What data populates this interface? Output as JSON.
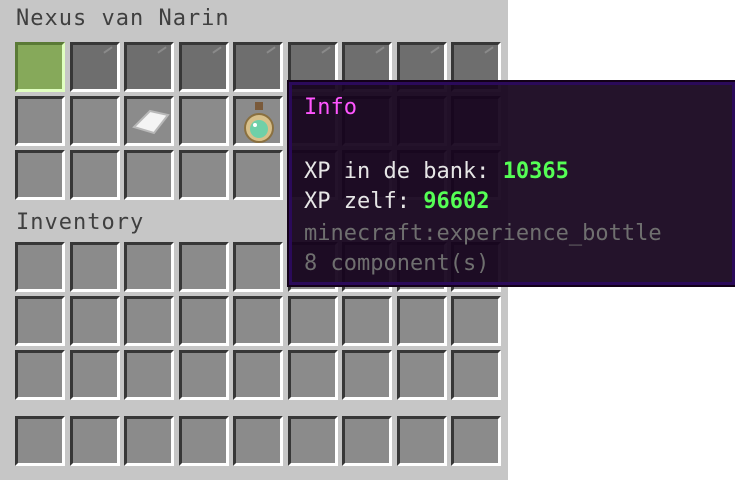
{
  "container": {
    "title": "Nexus van Narin"
  },
  "inventory": {
    "title": "Inventory"
  },
  "items": {
    "paper": {
      "icon": "paper-icon"
    },
    "bottle": {
      "icon": "experience-bottle-icon"
    }
  },
  "tooltip": {
    "title": "Info",
    "bank_label": "XP in de bank:",
    "bank_value": "10365",
    "self_label": "XP zelf:",
    "self_value": "96602",
    "item_id": "minecraft:experience_bottle",
    "components": "8 component(s)"
  },
  "colors": {
    "panel": "#c6c6c6",
    "slot": "#8b8b8b",
    "tooltip_title": "#ff55ff",
    "tooltip_value": "#55ff55"
  }
}
